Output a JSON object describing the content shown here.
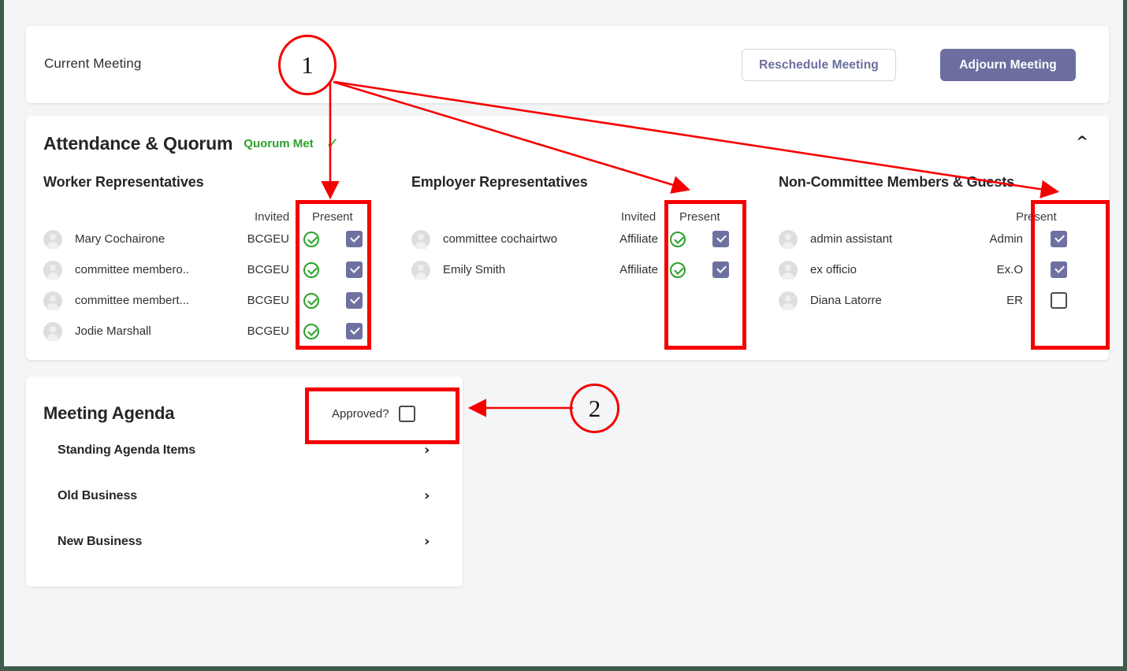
{
  "header": {
    "title": "Current Meeting",
    "reschedule_label": "Reschedule Meeting",
    "adjourn_label": "Adjourn Meeting"
  },
  "attendance": {
    "title": "Attendance & Quorum",
    "quorum_badge": "Quorum Met",
    "quorum_check_icon": "check-icon",
    "collapse_icon": "chevron-up-icon",
    "columns": {
      "invited": "Invited",
      "present": "Present"
    },
    "groups": [
      {
        "title": "Worker Representatives",
        "show_invited": true,
        "people": [
          {
            "name": "Mary Cochairone",
            "role": "BCGEU",
            "invited": true,
            "present": true
          },
          {
            "name": "committee membero..",
            "role": "BCGEU",
            "invited": true,
            "present": true
          },
          {
            "name": "committee membert...",
            "role": "BCGEU",
            "invited": true,
            "present": true
          },
          {
            "name": "Jodie Marshall",
            "role": "BCGEU",
            "invited": true,
            "present": true
          }
        ]
      },
      {
        "title": "Employer Representatives",
        "show_invited": true,
        "people": [
          {
            "name": "committee cochairtwo",
            "role": "Affiliate",
            "invited": true,
            "present": true
          },
          {
            "name": "Emily Smith",
            "role": "Affiliate",
            "invited": true,
            "present": true
          }
        ]
      },
      {
        "title": "Non-Committee Members & Guests",
        "show_invited": false,
        "people": [
          {
            "name": "admin assistant",
            "role": "Admin",
            "invited": false,
            "present": true
          },
          {
            "name": "ex officio",
            "role": "Ex.O",
            "invited": false,
            "present": true
          },
          {
            "name": "Diana Latorre",
            "role": "ER",
            "invited": false,
            "present": false
          }
        ]
      }
    ]
  },
  "agenda": {
    "title": "Meeting Agenda",
    "approved_label": "Approved?",
    "approved_checked": false,
    "items": [
      {
        "label": "Standing Agenda Items",
        "chevron": "chevron-right-icon"
      },
      {
        "label": "Old Business",
        "chevron": "chevron-right-icon"
      },
      {
        "label": "New Business",
        "chevron": "chevron-right-icon"
      }
    ]
  },
  "annotations": {
    "accent_color": "#f50000",
    "markers": [
      {
        "label": "1",
        "shape": "ellipse"
      },
      {
        "label": "2",
        "shape": "circle"
      }
    ]
  },
  "theme": {
    "accent_purple": "#6e71a0",
    "success_green": "#2aa32a",
    "page_background": "#f4f5f6",
    "page_border": "#3f5c4a"
  }
}
